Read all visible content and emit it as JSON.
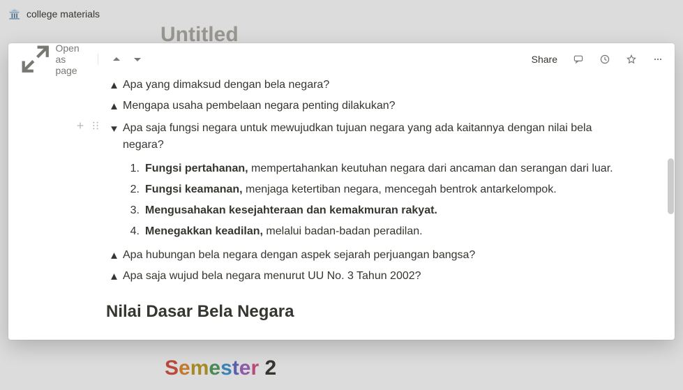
{
  "background": {
    "breadcrumb_icon": "🏛️",
    "breadcrumb_text": "college materials",
    "page_title": "Untitled",
    "footer_title": "Semester 2"
  },
  "modal": {
    "open_as_page": "Open as page",
    "share_label": "Share",
    "toggles": [
      {
        "expanded": false,
        "text": "Apa yang dimaksud dengan bela negara?"
      },
      {
        "expanded": false,
        "text": "Mengapa usaha pembelaan negara penting dilakukan?"
      },
      {
        "expanded": true,
        "text": "Apa saja fungsi negara untuk mewujudkan tujuan negara yang ada kaitannya dengan nilai bela negara?",
        "items": [
          {
            "num": "1.",
            "bold": "Fungsi pertahanan,",
            "rest": " mempertahankan keutuhan negara dari ancaman dan serangan dari luar."
          },
          {
            "num": "2.",
            "bold": "Fungsi keamanan,",
            "rest": " menjaga ketertiban negara, mencegah bentrok antarkelompok."
          },
          {
            "num": "3.",
            "bold": "Mengusahakan kesejahteraan dan kemakmuran rakyat.",
            "rest": ""
          },
          {
            "num": "4.",
            "bold": "Menegakkan keadilan,",
            "rest": " melalui badan-badan peradilan."
          }
        ]
      },
      {
        "expanded": false,
        "text": "Apa hubungan bela negara dengan aspek sejarah perjuangan bangsa?"
      },
      {
        "expanded": false,
        "text": "Apa saja wujud bela negara menurut UU No. 3 Tahun 2002?"
      }
    ],
    "heading": "Nilai Dasar Bela Negara"
  }
}
